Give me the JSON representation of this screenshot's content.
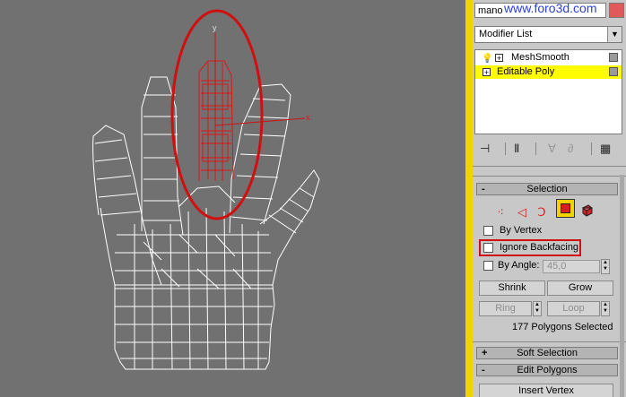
{
  "app": {
    "object_name": "mano",
    "watermark": "www.foro3d.com"
  },
  "viewport": {
    "axis_x_label": "x",
    "axis_y_label": "y",
    "annotation_color": "#d01010",
    "wire_color": "#ffffff",
    "selected_color": "#e01515"
  },
  "modifier": {
    "list_label": "Modifier List",
    "stack": [
      {
        "label": "MeshSmooth",
        "selected": false
      },
      {
        "label": "Editable Poly",
        "selected": true
      }
    ]
  },
  "toolbar": {
    "icons": [
      "pin-stack-icon",
      "show-end-result-icon",
      "make-unique-icon",
      "remove-modifier-icon",
      "configure-sets-icon"
    ]
  },
  "selection": {
    "title": "Selection",
    "collapse_sign": "-",
    "by_vertex_label": "By Vertex",
    "ignore_backfacing_label": "Ignore Backfacing",
    "by_angle_label": "By Angle:",
    "angle_value": "45,0",
    "shrink_label": "Shrink",
    "grow_label": "Grow",
    "ring_label": "Ring",
    "loop_label": "Loop",
    "count_text": "177 Polygons Selected"
  },
  "soft_selection": {
    "title": "Soft Selection",
    "sign": "+"
  },
  "edit_polygons": {
    "title": "Edit Polygons",
    "sign": "-",
    "insert_vertex_label": "Insert Vertex"
  }
}
